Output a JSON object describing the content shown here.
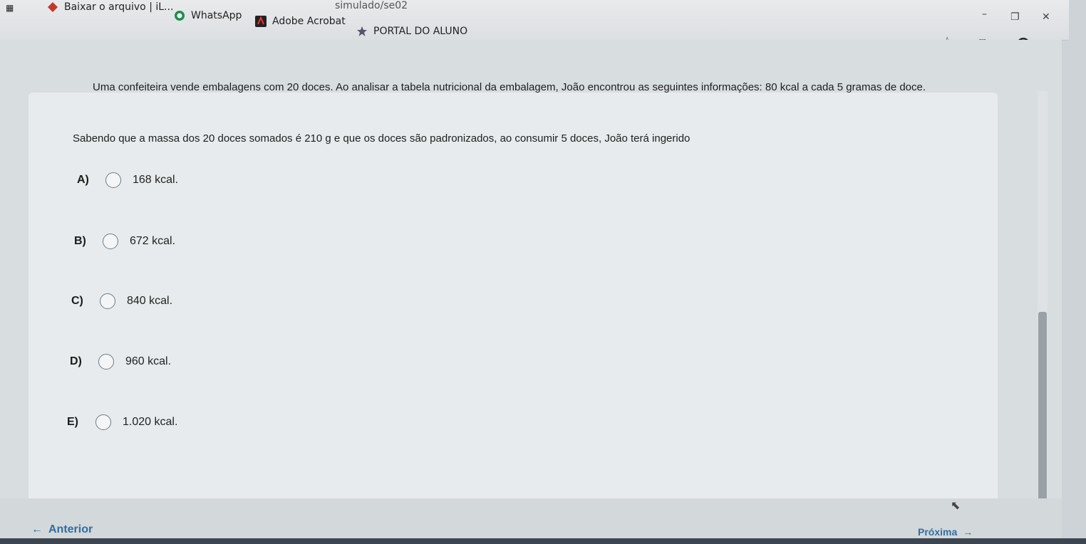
{
  "browser": {
    "url_fragment": "simulado/se02",
    "bookmarks": [
      {
        "label": "Baixar o arquivo | iL...",
        "icon": "diamond-icon"
      },
      {
        "label": "WhatsApp",
        "icon": "whatsapp-icon"
      },
      {
        "label": "Adobe Acrobat",
        "icon": "acrobat-icon"
      },
      {
        "label": "PORTAL DO ALUNO",
        "icon": "star-icon"
      }
    ],
    "colors": {
      "accent": "#2f6fa3"
    }
  },
  "question": {
    "line1": "Uma confeiteira vende embalagens com 20 doces. Ao analisar a tabela nutricional da embalagem, João encontrou as seguintes informações: 80 kcal a cada 5 gramas de doce.",
    "line2": "Sabendo que a massa dos 20 doces somados é 210 g e que os doces são padronizados, ao consumir 5 doces, João terá ingerido"
  },
  "options": [
    {
      "letter": "A)",
      "text": "168 kcal."
    },
    {
      "letter": "B)",
      "text": "672 kcal."
    },
    {
      "letter": "C)",
      "text": "840 kcal."
    },
    {
      "letter": "D)",
      "text": "960 kcal."
    },
    {
      "letter": "E)",
      "text": "1.020 kcal."
    }
  ],
  "nav": {
    "prev": "Anterior",
    "next": "Próxima"
  }
}
